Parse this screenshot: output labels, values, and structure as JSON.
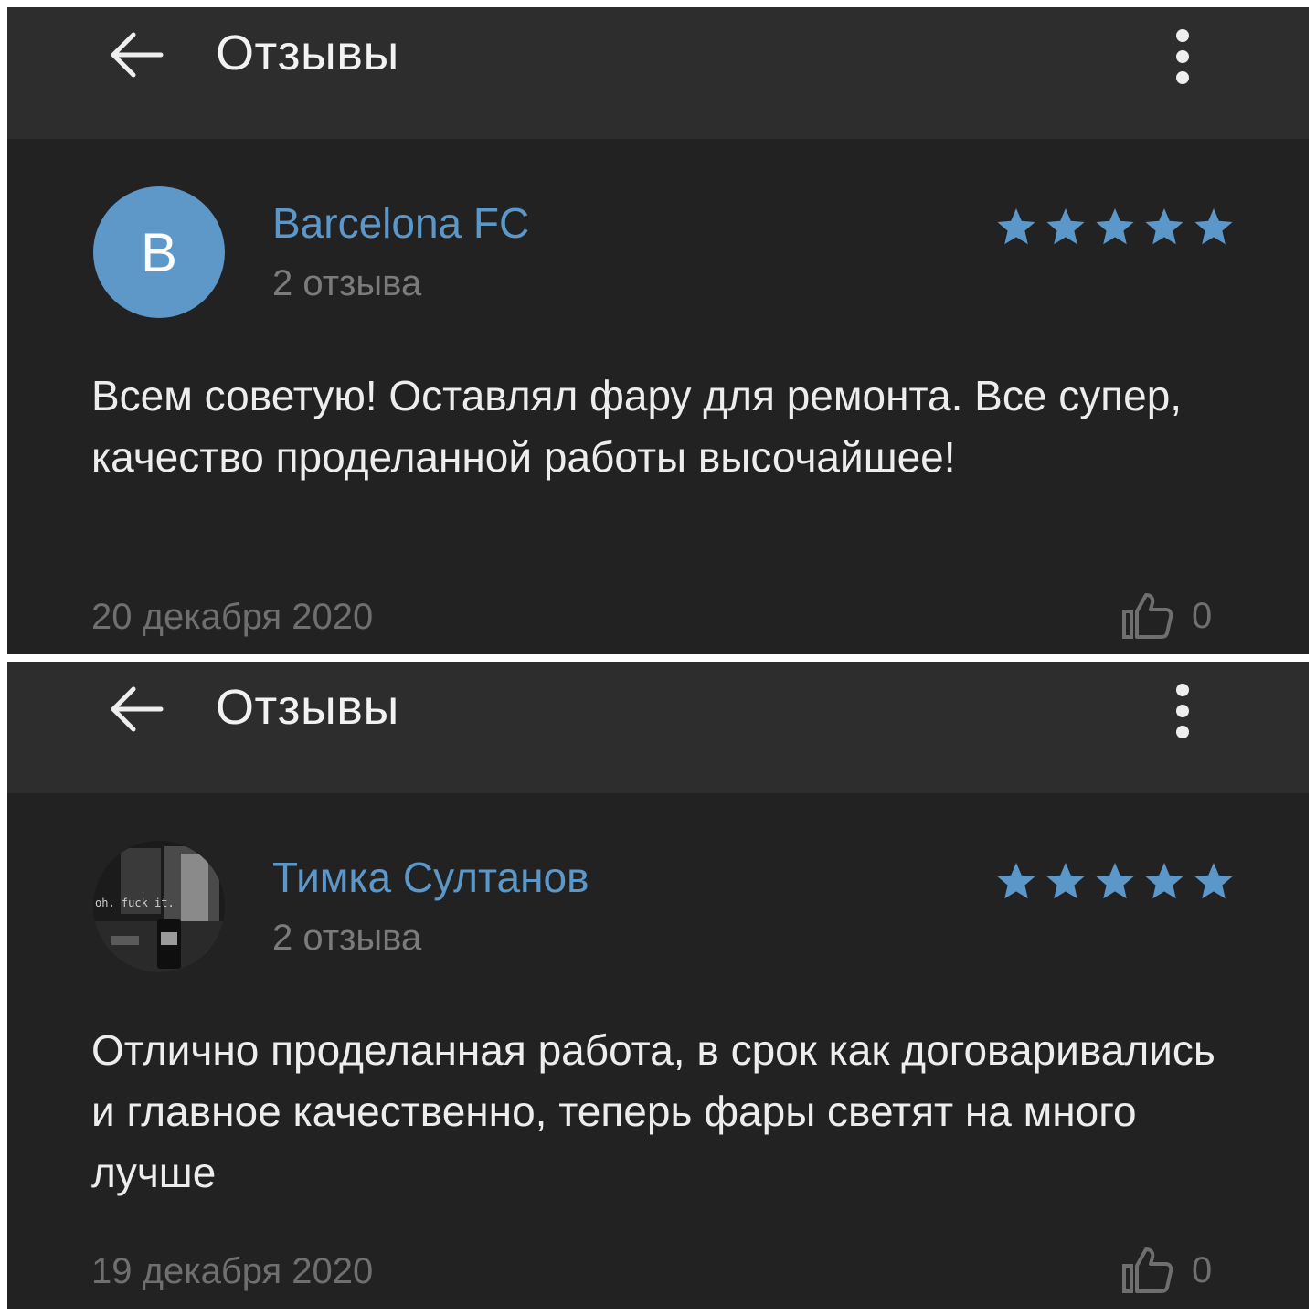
{
  "accent_color": "#5b97c9",
  "star_color": "#5b97c9",
  "screens": [
    {
      "header": {
        "title": "Отзывы",
        "back_icon": "arrow-left-icon",
        "menu_icon": "more-vertical-icon"
      },
      "review": {
        "avatar_type": "letter",
        "avatar_letter": "B",
        "avatar_color": "#5d98c8",
        "author": "Barcelona FC",
        "review_count": "2 отзыва",
        "rating": 5,
        "rating_max": 5,
        "text": "Всем советую! Оставлял фару для ремонта. Все супер, качество проделанной работы высочайшее!",
        "date": "20 декабря 2020",
        "likes": "0"
      }
    },
    {
      "header": {
        "title": "Отзывы",
        "back_icon": "arrow-left-icon",
        "menu_icon": "more-vertical-icon"
      },
      "review": {
        "avatar_type": "photo",
        "avatar_caption": "oh, fuck it.",
        "author": "Тимка Султанов",
        "review_count": "2 отзыва",
        "rating": 5,
        "rating_max": 5,
        "text": "Отлично проделанная работа, в срок как договаривались и главное качественно, теперь фары светят на много лучше",
        "date": "19 декабря 2020",
        "likes": "0"
      }
    }
  ]
}
